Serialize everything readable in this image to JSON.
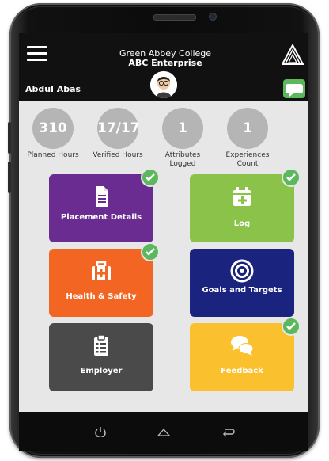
{
  "header": {
    "college": "Green Abbey College",
    "enterprise": "ABC Enterprise",
    "username": "Abdul Abas"
  },
  "stats": [
    {
      "value": "310",
      "label": "Planned Hours"
    },
    {
      "value": "17/17",
      "label": "Verified Hours"
    },
    {
      "value": "1",
      "label": "Attributes Logged"
    },
    {
      "value": "1",
      "label": "Experiences Count"
    }
  ],
  "tiles": {
    "placement": {
      "label": "Placement Details",
      "color": "#6a2c91",
      "icon": "document-icon",
      "checked": true
    },
    "log": {
      "label": "Log",
      "color": "#8bc34a",
      "icon": "calendar-plus-icon",
      "checked": true
    },
    "health": {
      "label": "Health & Safety",
      "color": "#f26522",
      "icon": "first-aid-kit-icon",
      "checked": true
    },
    "goals": {
      "label": "Goals and Targets",
      "color": "#1a237e",
      "icon": "target-icon",
      "checked": false
    },
    "employer": {
      "label": "Employer",
      "color": "#4a4a4a",
      "icon": "clipboard-list-icon",
      "checked": false
    },
    "feedback": {
      "label": "Feedback",
      "color": "#fbc02d",
      "icon": "chat-bubbles-icon",
      "checked": true
    }
  },
  "colors": {
    "header": "#111111",
    "background": "#e7e7e7",
    "check": "#5cb85c",
    "stat_circle": "#b5b5b5"
  }
}
